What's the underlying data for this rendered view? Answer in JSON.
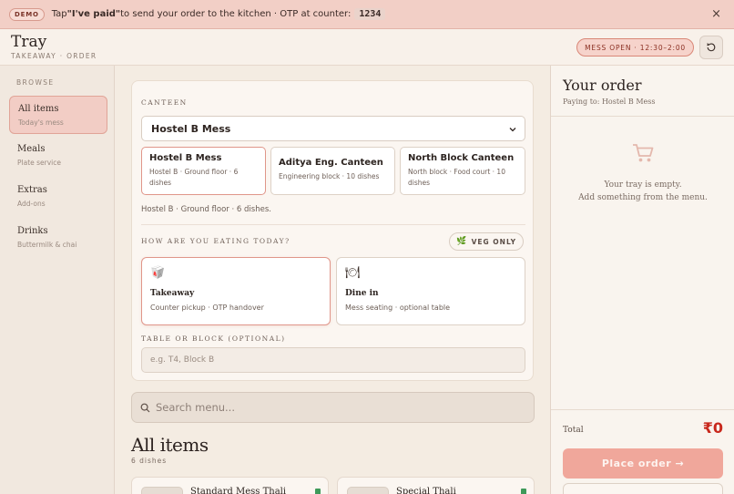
{
  "banner": {
    "badge": "DEMO",
    "text_pre": "Tap ",
    "text_bold": "\"I've paid\"",
    "text_post": " to send your order to the kitchen · OTP at counter:",
    "otp": "1234",
    "close_glyph": "×"
  },
  "header": {
    "title": "Tray",
    "subtitle": "TAKEAWAY · ORDER",
    "status": "MESS OPEN · 12:30–2:00",
    "refresh_icon": "refresh-icon"
  },
  "sidebar": {
    "heading": "BROWSE",
    "items": [
      {
        "label": "All items",
        "sub": "Today's mess",
        "active": true
      },
      {
        "label": "Meals",
        "sub": "Plate service",
        "active": false
      },
      {
        "label": "Extras",
        "sub": "Add-ons",
        "active": false
      },
      {
        "label": "Drinks",
        "sub": "Buttermilk & chai",
        "active": false
      }
    ]
  },
  "canteen": {
    "label": "CANTEEN",
    "selected": "Hostel B Mess",
    "options": [
      {
        "name": "Hostel B Mess",
        "desc": "Hostel B · Ground floor · 6 dishes"
      },
      {
        "name": "Aditya Eng. Canteen",
        "desc": "Engineering block · 10 dishes"
      },
      {
        "name": "North Block Canteen",
        "desc": "North block · Food court · 10 dishes"
      }
    ],
    "info": "Hostel B · Ground floor · 6 dishes."
  },
  "mode": {
    "label": "HOW ARE YOU EATING TODAY?",
    "veg_only": "VEG ONLY",
    "options": [
      {
        "title": "Takeaway",
        "desc": "Counter pickup · OTP handover",
        "icon": "takeaway-bag-icon",
        "glyph": "🥡"
      },
      {
        "title": "Dine in",
        "desc": "Mess seating · optional table",
        "icon": "dine-in-icon",
        "glyph": "🍽"
      }
    ]
  },
  "table": {
    "label": "TABLE OR BLOCK (OPTIONAL)",
    "placeholder": "e.g. T4, Block B",
    "value": ""
  },
  "search": {
    "placeholder": "Search menu..."
  },
  "menu": {
    "title": "All items",
    "count": "6 dishes",
    "dishes": [
      {
        "name": "Standard Mess Thali"
      },
      {
        "name": "Special Thali"
      }
    ]
  },
  "order": {
    "title": "Your order",
    "paying_to": "Paying to: Hostel B Mess",
    "empty_line1": "Your tray is empty.",
    "empty_line2": "Add something from the menu.",
    "total_label": "Total",
    "total_value": "₹0",
    "place_button": "Place order →"
  },
  "colors": {
    "accent": "#f0a79b",
    "accent_border": "#e0968a",
    "total_red": "#c8281c",
    "veg_green": "#3e9a5a",
    "banner_bg": "#f2cfc6"
  }
}
